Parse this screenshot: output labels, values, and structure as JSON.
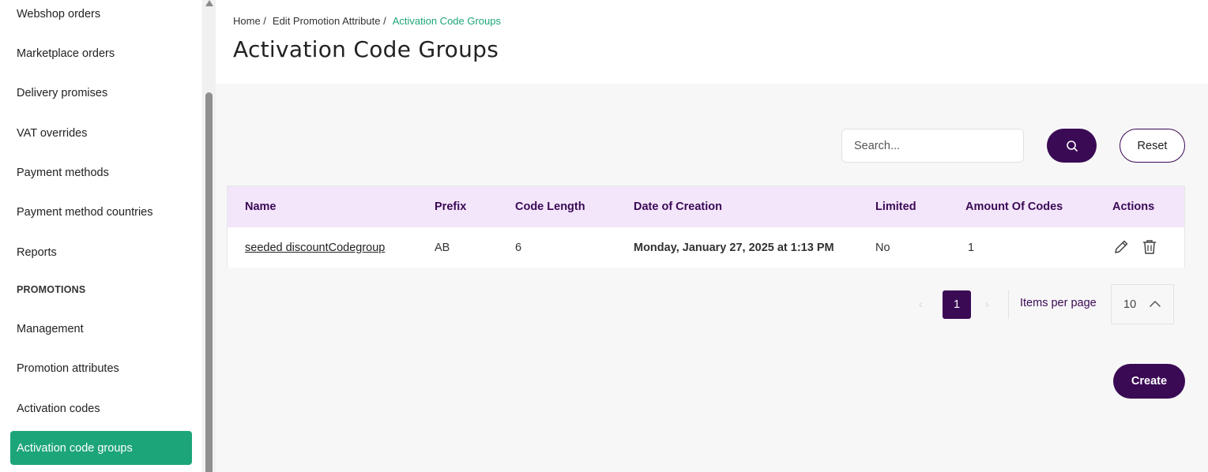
{
  "sidebar": {
    "items": [
      {
        "label": "Webshop orders"
      },
      {
        "label": "Marketplace orders"
      },
      {
        "label": "Delivery promises"
      },
      {
        "label": "VAT overrides"
      },
      {
        "label": "Payment methods"
      },
      {
        "label": "Payment method countries"
      },
      {
        "label": "Reports"
      }
    ],
    "section_promotions": "PROMOTIONS",
    "promo_items": [
      {
        "label": "Management"
      },
      {
        "label": "Promotion attributes"
      },
      {
        "label": "Activation codes"
      },
      {
        "label": "Activation code groups",
        "active": true
      }
    ]
  },
  "breadcrumb": [
    "Home /",
    "Edit Promotion Attribute /",
    "Activation Code Groups"
  ],
  "page_title": "Activation Code Groups",
  "search": {
    "placeholder": "Search...",
    "value": "",
    "button_icon": "search-icon"
  },
  "reset_label": "Reset",
  "table": {
    "columns": [
      "Name",
      "Prefix",
      "Code Length",
      "Date of Creation",
      "Limited",
      "Amount Of Codes",
      "Actions"
    ],
    "rows": [
      {
        "name": "seeded discountCodegroup",
        "prefix": "AB",
        "code_length": "6",
        "date_of_creation": "Monday, January 27, 2025 at 1:13 PM",
        "limited": "No",
        "amount_of_codes": "1",
        "actions": [
          "pencil-icon",
          "trash-icon"
        ]
      }
    ]
  },
  "pagination": {
    "prev": "‹",
    "current_page": "1",
    "next": "›",
    "items_per_page_label": "Items per page",
    "items_per_page": "10"
  },
  "create_label": "Create",
  "colors": {
    "accent": "#1da57a",
    "brand": "#3a0a55",
    "table_header_bg": "#f3e6fb"
  }
}
